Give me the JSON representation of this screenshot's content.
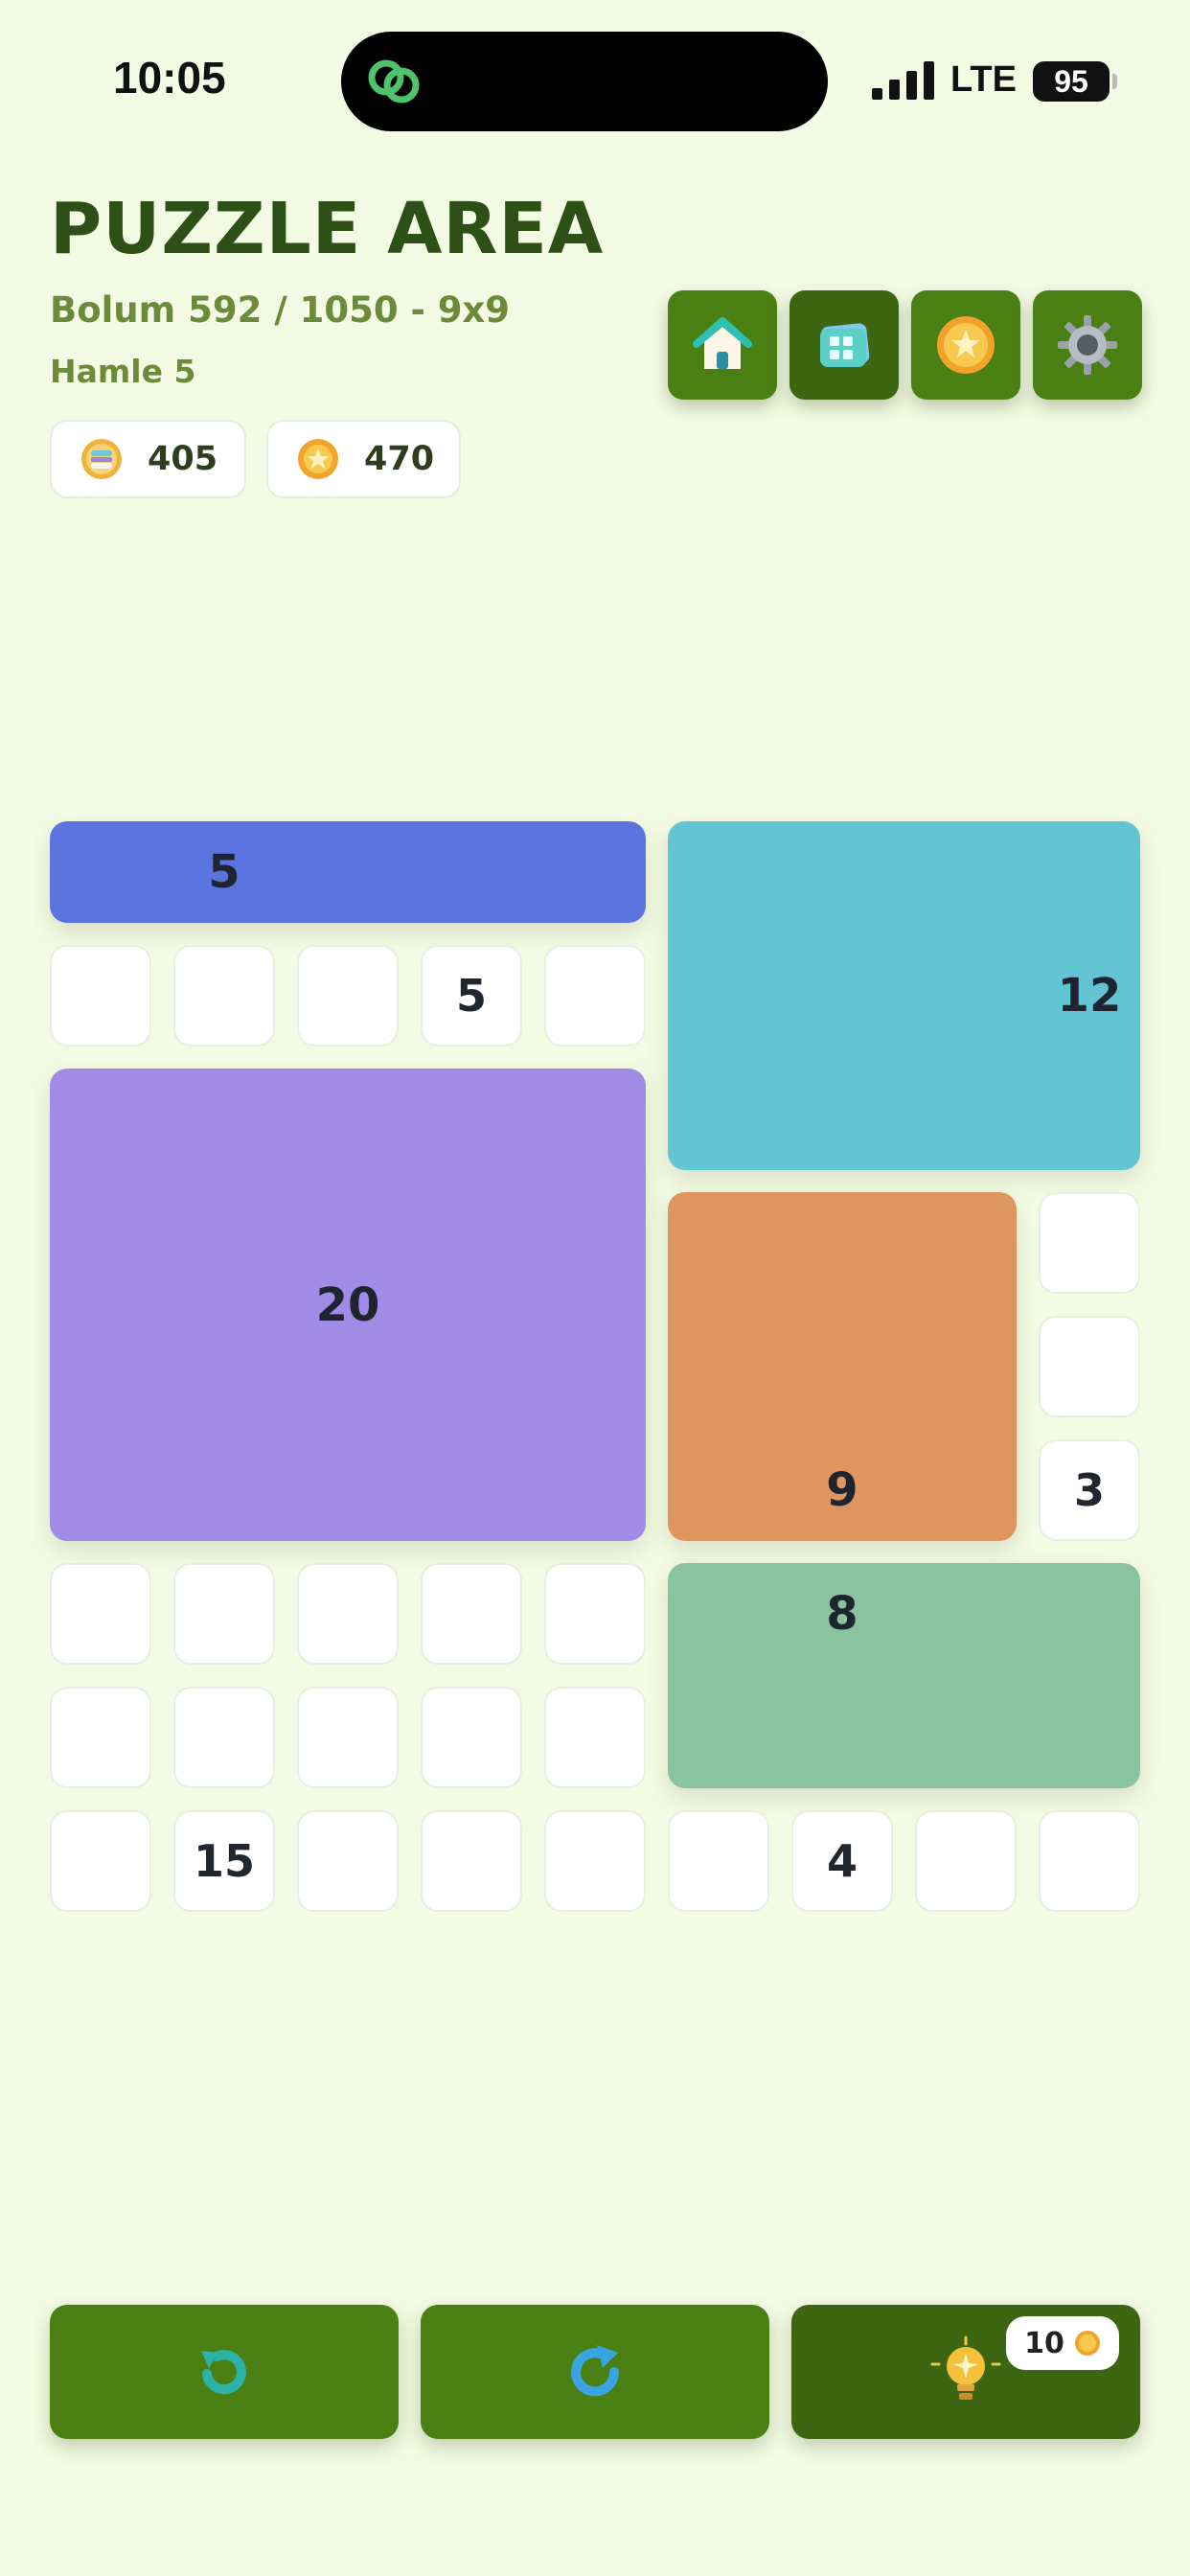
{
  "status_bar": {
    "time": "10:05",
    "network": "LTE",
    "battery": "95"
  },
  "header": {
    "title": "PUZZLE AREA",
    "subtitle": "Bolum 592 / 1050 - 9x9",
    "moves": "Hamle 5"
  },
  "currencies": [
    {
      "icon": "gem-coin-icon",
      "value": "405"
    },
    {
      "icon": "gold-coin-icon",
      "value": "470"
    }
  ],
  "toolbar": [
    {
      "icon": "home-icon"
    },
    {
      "icon": "level-grid-icon"
    },
    {
      "icon": "coin-shop-icon"
    },
    {
      "icon": "gear-icon"
    }
  ],
  "board": {
    "size": 9,
    "cells": [
      {
        "row": 1,
        "col": 0,
        "value": ""
      },
      {
        "row": 1,
        "col": 1,
        "value": ""
      },
      {
        "row": 1,
        "col": 2,
        "value": ""
      },
      {
        "row": 1,
        "col": 3,
        "value": "5"
      },
      {
        "row": 1,
        "col": 4,
        "value": ""
      },
      {
        "row": 3,
        "col": 8,
        "value": ""
      },
      {
        "row": 4,
        "col": 8,
        "value": ""
      },
      {
        "row": 5,
        "col": 8,
        "value": "3"
      },
      {
        "row": 6,
        "col": 0,
        "value": ""
      },
      {
        "row": 6,
        "col": 1,
        "value": ""
      },
      {
        "row": 6,
        "col": 2,
        "value": ""
      },
      {
        "row": 6,
        "col": 3,
        "value": ""
      },
      {
        "row": 6,
        "col": 4,
        "value": ""
      },
      {
        "row": 7,
        "col": 0,
        "value": ""
      },
      {
        "row": 7,
        "col": 1,
        "value": ""
      },
      {
        "row": 7,
        "col": 2,
        "value": ""
      },
      {
        "row": 7,
        "col": 3,
        "value": ""
      },
      {
        "row": 7,
        "col": 4,
        "value": ""
      },
      {
        "row": 8,
        "col": 0,
        "value": ""
      },
      {
        "row": 8,
        "col": 1,
        "value": "15"
      },
      {
        "row": 8,
        "col": 2,
        "value": ""
      },
      {
        "row": 8,
        "col": 3,
        "value": ""
      },
      {
        "row": 8,
        "col": 4,
        "value": ""
      },
      {
        "row": 8,
        "col": 5,
        "value": ""
      },
      {
        "row": 8,
        "col": 6,
        "value": "4"
      },
      {
        "row": 8,
        "col": 7,
        "value": ""
      },
      {
        "row": 8,
        "col": 8,
        "value": ""
      }
    ],
    "blocks": [
      {
        "row": 0,
        "col": 0,
        "rows": 1,
        "cols": 5,
        "color": "#5b74e0",
        "label": "5",
        "label_row": 0,
        "label_col": 1
      },
      {
        "row": 0,
        "col": 5,
        "rows": 3,
        "cols": 4,
        "color": "#63c4d3",
        "label": "12",
        "label_row": 1,
        "label_col": 8
      },
      {
        "row": 2,
        "col": 0,
        "rows": 4,
        "cols": 5,
        "color": "#a08be6",
        "label": "20",
        "label_row": 3.5,
        "label_col": 2
      },
      {
        "row": 3,
        "col": 5,
        "rows": 3,
        "cols": 3,
        "color": "#de955e",
        "label": "9",
        "label_row": 5,
        "label_col": 6
      },
      {
        "row": 6,
        "col": 5,
        "rows": 2,
        "cols": 4,
        "color": "#8ac3a0",
        "label": "8",
        "label_row": 6,
        "label_col": 6
      }
    ]
  },
  "controls": {
    "undo": {
      "icon": "undo-icon"
    },
    "restart": {
      "icon": "restart-icon"
    },
    "hint": {
      "icon": "lightbulb-icon",
      "cost": "10"
    }
  }
}
